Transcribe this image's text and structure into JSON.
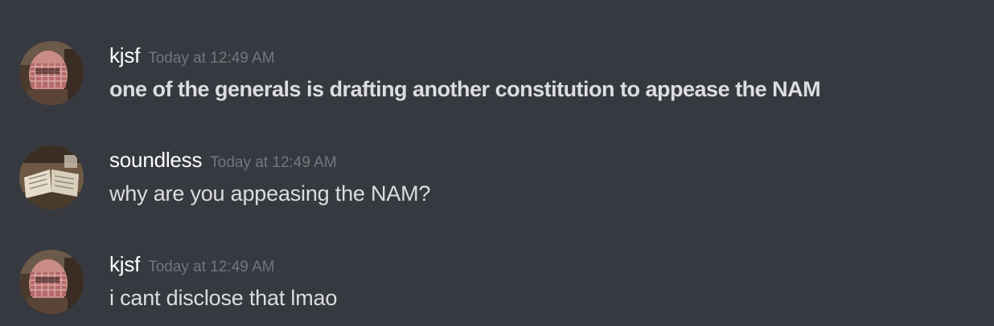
{
  "messages": [
    {
      "username": "kjsf",
      "timestamp": "Today at 12:49 AM",
      "text": "one of the generals is drafting another constitution to appease the NAM",
      "bold": true,
      "avatar_icon": "keffiyeh-portrait"
    },
    {
      "username": "soundless",
      "timestamp": "Today at 12:49 AM",
      "text": "why are you appeasing the NAM?",
      "bold": false,
      "avatar_icon": "open-book-photo"
    },
    {
      "username": "kjsf",
      "timestamp": "Today at 12:49 AM",
      "text": "i cant disclose that lmao",
      "bold": false,
      "avatar_icon": "keffiyeh-portrait"
    }
  ],
  "colors": {
    "background": "#36393f",
    "username": "#ffffff",
    "timestamp": "#72767d",
    "text": "#dcddde"
  }
}
